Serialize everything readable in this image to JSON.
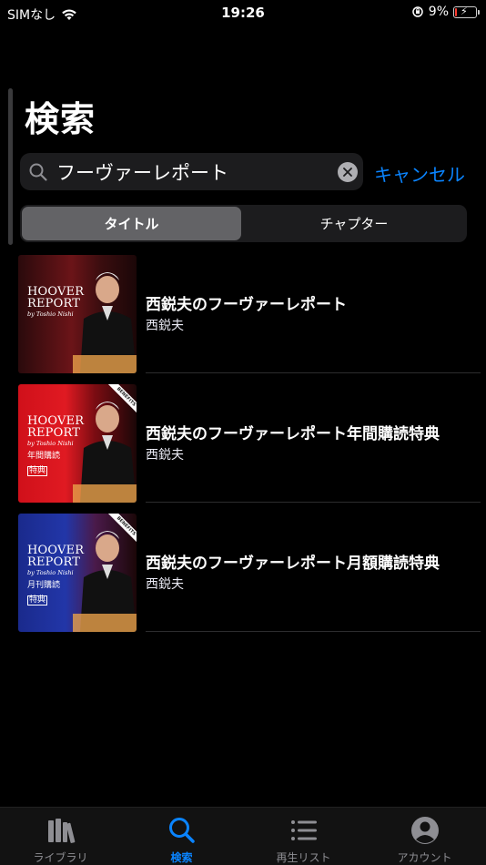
{
  "status_bar": {
    "carrier": "SIMなし",
    "time": "19:26",
    "battery_percent": "9%",
    "battery_level": 0.09
  },
  "page": {
    "title": "検索"
  },
  "search": {
    "value": "フーヴァーレポート",
    "cancel_label": "キャンセル"
  },
  "segments": {
    "title": "タイトル",
    "chapter": "チャプター",
    "selected": "title"
  },
  "results": [
    {
      "title": "西鋭夫のフーヴァーレポート",
      "author": "西鋭夫",
      "cover": {
        "title1": "HOOVER",
        "title2": "REPORT",
        "sub": "by Toshio Nishi",
        "tag1": "",
        "tag2": "",
        "benefits": "",
        "bg": "#5a0f12"
      }
    },
    {
      "title": "西鋭夫のフーヴァーレポート年間購読特典",
      "author": "西鋭夫",
      "cover": {
        "title1": "HOOVER",
        "title2": "REPORT",
        "sub": "by Toshio Nishi",
        "tag1": "年間購読",
        "tag2": "特典",
        "benefits": "BENEFITS",
        "bg": "#c8101a"
      }
    },
    {
      "title": "西鋭夫のフーヴァーレポート月額購読特典",
      "author": "西鋭夫",
      "cover": {
        "title1": "HOOVER",
        "title2": "REPORT",
        "sub": "by Toshio Nishi",
        "tag1": "月刊購読",
        "tag2": "特典",
        "benefits": "BENEFITS",
        "bg": "#1a2a8c"
      }
    }
  ],
  "tab_bar": {
    "items": [
      {
        "label": "ライブラリ",
        "icon": "library-icon"
      },
      {
        "label": "検索",
        "icon": "search-icon"
      },
      {
        "label": "再生リスト",
        "icon": "list-icon"
      },
      {
        "label": "アカウント",
        "icon": "account-icon"
      }
    ],
    "active": 1
  },
  "colors": {
    "accent": "#0a84ff",
    "background": "#000000",
    "battery_low": "#ff3b30"
  }
}
